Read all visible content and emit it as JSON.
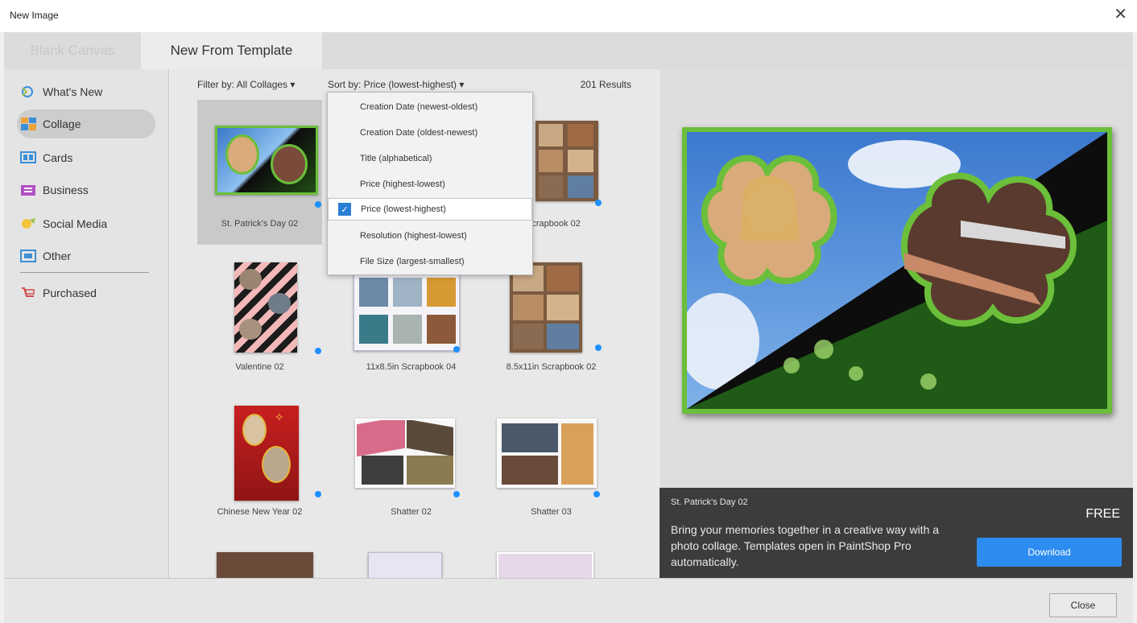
{
  "window": {
    "title": "New Image",
    "close_glyph": "✕"
  },
  "tabs": [
    {
      "label": "Blank Canvas",
      "active": false
    },
    {
      "label": "New From Template",
      "active": true
    }
  ],
  "sidebar": {
    "items": [
      {
        "label": "What's New",
        "icon": "whats-new-icon"
      },
      {
        "label": "Collage",
        "icon": "collage-icon",
        "selected": true
      },
      {
        "label": "Cards",
        "icon": "cards-icon"
      },
      {
        "label": "Business",
        "icon": "business-icon"
      },
      {
        "label": "Social Media",
        "icon": "social-media-icon"
      },
      {
        "label": "Other",
        "icon": "other-icon"
      },
      {
        "label": "Purchased",
        "icon": "purchased-icon"
      }
    ]
  },
  "toolbar": {
    "filter_label": "Filter by: All Collages ▾",
    "sort_label": "Sort by: Price (lowest-highest) ▾",
    "results": "201 Results"
  },
  "templates": [
    {
      "label": "St. Patrick's Day 02",
      "selected": true
    },
    {
      "label": "Scrapbook 02"
    },
    {
      "label": "Valentine 02"
    },
    {
      "label": "11x8.5in Scrapbook 04"
    },
    {
      "label": "8.5x11in Scrapbook 02"
    },
    {
      "label": "Chinese New Year 02"
    },
    {
      "label": "Shatter 02"
    },
    {
      "label": "Shatter 03"
    }
  ],
  "sort_menu": {
    "items": [
      {
        "label": "Creation Date (newest-oldest)"
      },
      {
        "label": "Creation Date (oldest-newest)"
      },
      {
        "label": "Title (alphabetical)"
      },
      {
        "label": "Price (highest-lowest)"
      },
      {
        "label": "Price (lowest-highest)",
        "checked": true
      },
      {
        "label": "Resolution (highest-lowest)"
      },
      {
        "label": "File Size (largest-smallest)"
      }
    ]
  },
  "details": {
    "name": "St. Patrick's Day 02",
    "price": "FREE",
    "description": "Bring your memories together in a creative way with a photo collage. Templates open in PaintShop Pro automatically.",
    "download_label": "Download"
  },
  "footer": {
    "close_label": "Close"
  },
  "colors": {
    "accent": "#2d8cf0",
    "clover_green": "#6bbf3a",
    "info_bg": "#3c3c3c"
  }
}
